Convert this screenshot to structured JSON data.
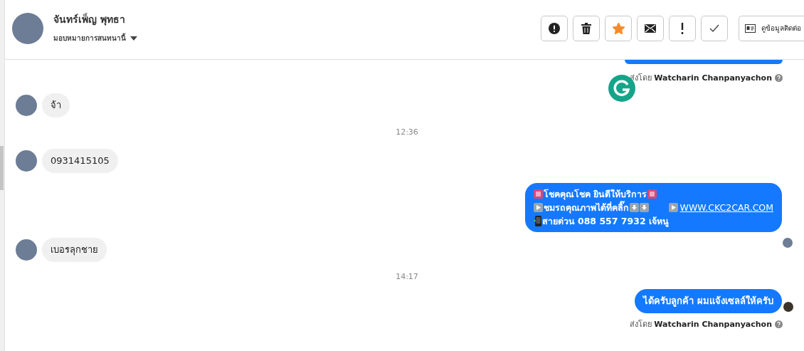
{
  "header": {
    "name": "จันทร์เพ็ญ พุทธา",
    "assign": "มอบหมายการสนทนานี้",
    "actions": [
      {
        "kind": "alert"
      },
      {
        "kind": "trash"
      },
      {
        "kind": "star",
        "selected": true
      },
      {
        "kind": "mail"
      },
      {
        "kind": "exclaim"
      },
      {
        "kind": "check"
      }
    ],
    "contact_button": "ดูข้อมูลติดต่อ"
  },
  "messages": [
    {
      "kind": "out-cut"
    },
    {
      "kind": "sent-by",
      "prefix": "ส่งโดย",
      "agent": "Watcharin Chanpanyachon"
    },
    {
      "kind": "in",
      "text": "จ้า"
    },
    {
      "kind": "time",
      "text": "12:36"
    },
    {
      "kind": "in",
      "text": "0931415105"
    },
    {
      "kind": "out-rich",
      "lines": [
        [
          {
            "kind": "frame"
          },
          {
            "kind": "text",
            "text": "โชคคุณโชค ยินดีให้บริการ"
          },
          {
            "kind": "frame"
          }
        ],
        [
          {
            "kind": "play"
          },
          {
            "kind": "text",
            "text": "ชมรถคุณภาพได้ที่คลิ๊ก"
          },
          {
            "kind": "down"
          },
          {
            "kind": "down"
          },
          {
            "kind": "gap"
          },
          {
            "kind": "play"
          },
          {
            "kind": "link",
            "text": "WWW.CKC2CAR.COM"
          }
        ],
        [
          {
            "kind": "phone"
          },
          {
            "kind": "text",
            "text": " สายด่วน 088 557 7932 เจ้หนู"
          }
        ]
      ]
    },
    {
      "kind": "seen"
    },
    {
      "kind": "in",
      "text": "เบอรลุกชาย"
    },
    {
      "kind": "time",
      "text": "14:17"
    },
    {
      "kind": "out",
      "text": "ได้ครับลูกค้า ผมแจ้งเซลล์ให้ครับ"
    },
    {
      "kind": "sent-by",
      "prefix": "ส่งโดย",
      "agent": "Watcharin Chanpanyachon"
    }
  ]
}
